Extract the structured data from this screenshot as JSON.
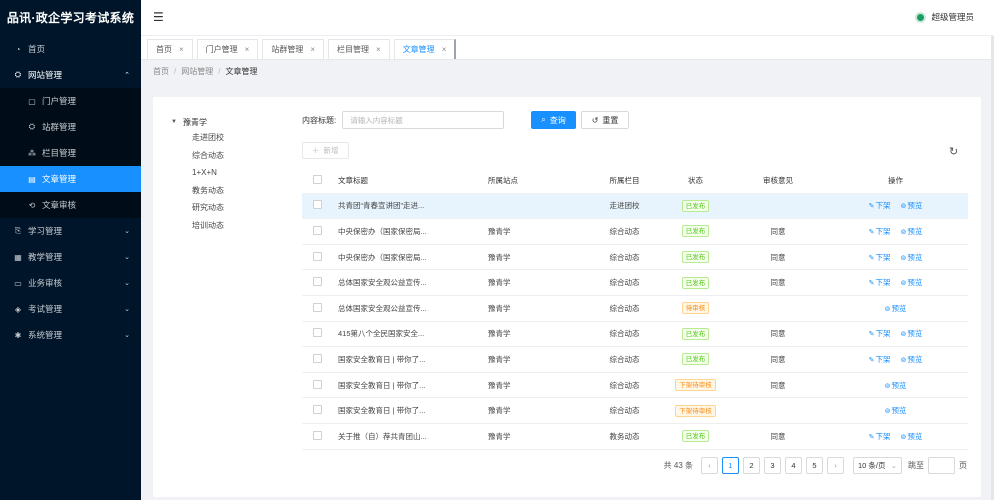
{
  "app": {
    "title": "品讯·政企学习考试系统"
  },
  "header": {
    "user_name": "超级管理员"
  },
  "sidebar": {
    "items": [
      {
        "label": "首页",
        "icon": "dashboard-icon",
        "glyph": "◔"
      },
      {
        "label": "网站管理",
        "icon": "cluster-icon",
        "glyph": "⛭",
        "arrow": "⌃",
        "open": true
      },
      {
        "label": "门户管理",
        "icon": "portal-icon",
        "glyph": "▢",
        "sub": true
      },
      {
        "label": "站群管理",
        "icon": "site-group-icon",
        "glyph": "⛭",
        "sub": true
      },
      {
        "label": "栏目管理",
        "icon": "column-icon",
        "glyph": "⁂",
        "sub": true
      },
      {
        "label": "文章管理",
        "icon": "article-icon",
        "glyph": "▤",
        "sub": true,
        "active": true
      },
      {
        "label": "文章审核",
        "icon": "audit-icon",
        "glyph": "⟲",
        "sub": true
      },
      {
        "label": "学习管理",
        "icon": "study-icon",
        "glyph": "⎘",
        "arrow": "⌄"
      },
      {
        "label": "教学管理",
        "icon": "teaching-icon",
        "glyph": "▦",
        "arrow": "⌄"
      },
      {
        "label": "业务审核",
        "icon": "business-audit-icon",
        "glyph": "▭",
        "arrow": "⌄"
      },
      {
        "label": "考试管理",
        "icon": "exam-icon",
        "glyph": "◈",
        "arrow": "⌄"
      },
      {
        "label": "系统管理",
        "icon": "settings-icon",
        "glyph": "✱",
        "arrow": "⌄"
      }
    ]
  },
  "tabs": [
    {
      "label": "首页"
    },
    {
      "label": "门户管理"
    },
    {
      "label": "站群管理"
    },
    {
      "label": "栏目管理"
    },
    {
      "label": "文章管理",
      "active": true
    }
  ],
  "breadcrumb": {
    "home": "首页",
    "section": "网站管理",
    "current": "文章管理"
  },
  "tree": {
    "root": "豫青学",
    "children": [
      "走进团校",
      "综合动态",
      "1+X+N",
      "教务动态",
      "研究动态",
      "培训动态"
    ]
  },
  "search": {
    "label": "内容标题:",
    "placeholder": "请输入内容标题",
    "query_label": "查询",
    "reset_label": "重置"
  },
  "toolbar": {
    "add_label": "新增"
  },
  "table": {
    "headers": {
      "title": "文章标题",
      "site": "所属站点",
      "column": "所属栏目",
      "status": "状态",
      "opinion": "审核意见",
      "ops": "操作"
    },
    "rows": [
      {
        "title": "共青团“青春宣讲团”走进...",
        "site": "",
        "column": "走进团校",
        "status": "已发布",
        "status_type": "ok",
        "opinion": "",
        "ops": [
          "下架",
          "预览"
        ],
        "highlight": true
      },
      {
        "title": "中央保密办（国家保密局...",
        "site": "豫青学",
        "column": "综合动态",
        "status": "已发布",
        "status_type": "ok",
        "opinion": "同意",
        "ops": [
          "下架",
          "预览"
        ]
      },
      {
        "title": "中央保密办（国家保密局...",
        "site": "豫青学",
        "column": "综合动态",
        "status": "已发布",
        "status_type": "ok",
        "opinion": "同意",
        "ops": [
          "下架",
          "预览"
        ]
      },
      {
        "title": "总体国家安全观公益宣传...",
        "site": "豫青学",
        "column": "综合动态",
        "status": "已发布",
        "status_type": "ok",
        "opinion": "同意",
        "ops": [
          "下架",
          "预览"
        ]
      },
      {
        "title": "总体国家安全观公益宣传...",
        "site": "豫青学",
        "column": "综合动态",
        "status": "待审核",
        "status_type": "warn",
        "opinion": "",
        "ops": [
          "预览"
        ]
      },
      {
        "title": "415第八个全民国家安全...",
        "site": "豫青学",
        "column": "综合动态",
        "status": "已发布",
        "status_type": "ok",
        "opinion": "同意",
        "ops": [
          "下架",
          "预览"
        ]
      },
      {
        "title": "国家安全教育日 | 带你了...",
        "site": "豫青学",
        "column": "综合动态",
        "status": "已发布",
        "status_type": "ok",
        "opinion": "同意",
        "ops": [
          "下架",
          "预览"
        ]
      },
      {
        "title": "国家安全教育日 | 带你了...",
        "site": "豫青学",
        "column": "综合动态",
        "status": "下架待审核",
        "status_type": "warn",
        "opinion": "同意",
        "ops": [
          "预览"
        ]
      },
      {
        "title": "国家安全教育日 | 带你了...",
        "site": "豫青学",
        "column": "综合动态",
        "status": "下架待审核",
        "status_type": "warn",
        "opinion": "",
        "ops": [
          "预览"
        ]
      },
      {
        "title": "关于推（自）荐共青团山...",
        "site": "豫青学",
        "column": "教务动态",
        "status": "已发布",
        "status_type": "ok",
        "opinion": "同意",
        "ops": [
          "下架",
          "预览"
        ]
      }
    ]
  },
  "pagination": {
    "total": "共 43 条",
    "pages": [
      "1",
      "2",
      "3",
      "4",
      "5"
    ],
    "current": "1",
    "page_size": "10 条/页",
    "jump_label": "跳至",
    "page_unit": "页"
  },
  "colors": {
    "sidebar_bg": "#001529",
    "accent": "#1890ff",
    "ok": "#52c41a",
    "warn": "#fa8c16"
  }
}
